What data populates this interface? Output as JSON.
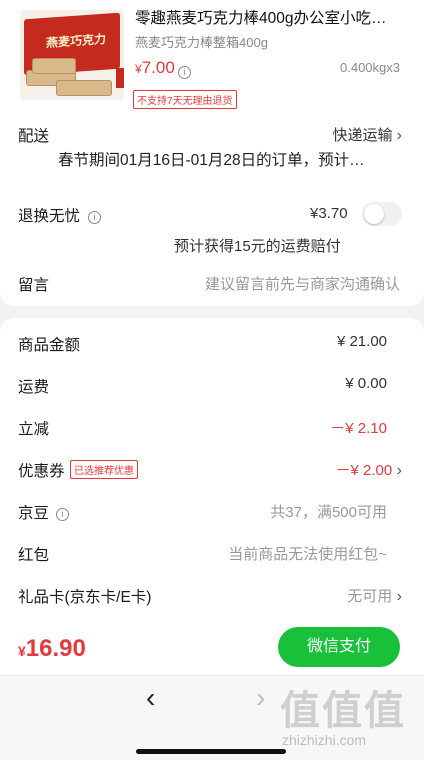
{
  "product": {
    "title": "零趣燕麦巧克力棒400g办公室小吃…",
    "spec": "燕麦巧克力棒整箱400g",
    "price_symbol": "¥",
    "price": "7.00",
    "weight": "0.400kgx3",
    "return_tag": "不支持7天无理由退货",
    "thumb_label": "燕麦巧克力"
  },
  "delivery": {
    "label": "配送",
    "method": "快递运输",
    "notice": "春节期间01月16日-01月28日的订单，预计…"
  },
  "worry_free": {
    "label": "退换无忧",
    "price": "¥3.70",
    "note": "预计获得15元的运费赔付",
    "enabled": false
  },
  "message": {
    "label": "留言",
    "placeholder": "建议留言前先与商家沟通确认"
  },
  "summary": {
    "goods_label": "商品金额",
    "goods_value": "¥ 21.00",
    "shipping_label": "运费",
    "shipping_value": "¥ 0.00",
    "discount_label": "立减",
    "discount_value": "－¥ 2.10",
    "coupon_label": "优惠券",
    "coupon_badge": "已选推荐优惠",
    "coupon_value": "－¥ 2.00",
    "jd_beans_label": "京豆",
    "jd_beans_value": "共37，满500可用",
    "redpacket_label": "红包",
    "redpacket_value": "当前商品无法使用红包~",
    "giftcard_label": "礼品卡(京东卡/E卡)",
    "giftcard_value": "无可用"
  },
  "pay": {
    "currency": "¥",
    "total": "16.90",
    "button": "微信支付"
  },
  "nav": {
    "back": "‹",
    "forward": "›"
  },
  "watermark": {
    "text": "值值值",
    "url": "zhizhizhi.com"
  },
  "colors": {
    "accent_red": "#e4393c",
    "wechat_green": "#19c13b"
  }
}
